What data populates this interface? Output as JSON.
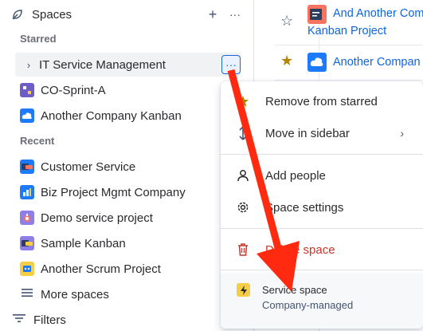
{
  "sidebar": {
    "title": "Spaces",
    "add_label": "+",
    "more_label": "···",
    "starred_label": "Starred",
    "recent_label": "Recent",
    "starred": [
      {
        "label": "IT Service Management"
      },
      {
        "label": "CO-Sprint-A"
      },
      {
        "label": "Another Company Kanban"
      }
    ],
    "recent": [
      {
        "label": "Customer Service"
      },
      {
        "label": "Biz Project Mgmt Company"
      },
      {
        "label": "Demo service project"
      },
      {
        "label": "Sample Kanban"
      },
      {
        "label": "Another Scrum Project"
      }
    ],
    "more_spaces": "More spaces",
    "filters": "Filters"
  },
  "content": {
    "rows": [
      {
        "title_line1": "And Another Comp",
        "title_line2": "Kanban Project",
        "starred": false
      },
      {
        "title_line1": "Another Compan",
        "starred": true
      }
    ]
  },
  "menu": {
    "items": [
      {
        "label": "Remove from starred",
        "icon": "star-icon"
      },
      {
        "label": "Move in sidebar",
        "icon": "move-icon"
      },
      {
        "label": "Add people",
        "icon": "person-icon"
      },
      {
        "label": "Space settings",
        "icon": "gear-icon"
      },
      {
        "label": "Delete space",
        "icon": "trash-icon"
      }
    ],
    "footer_title": "Service space",
    "footer_sub": "Company-managed"
  },
  "colors": {
    "accent": "#1868db",
    "danger": "#c9372c",
    "star": "#b38600",
    "arrow": "#ff2a0f"
  }
}
